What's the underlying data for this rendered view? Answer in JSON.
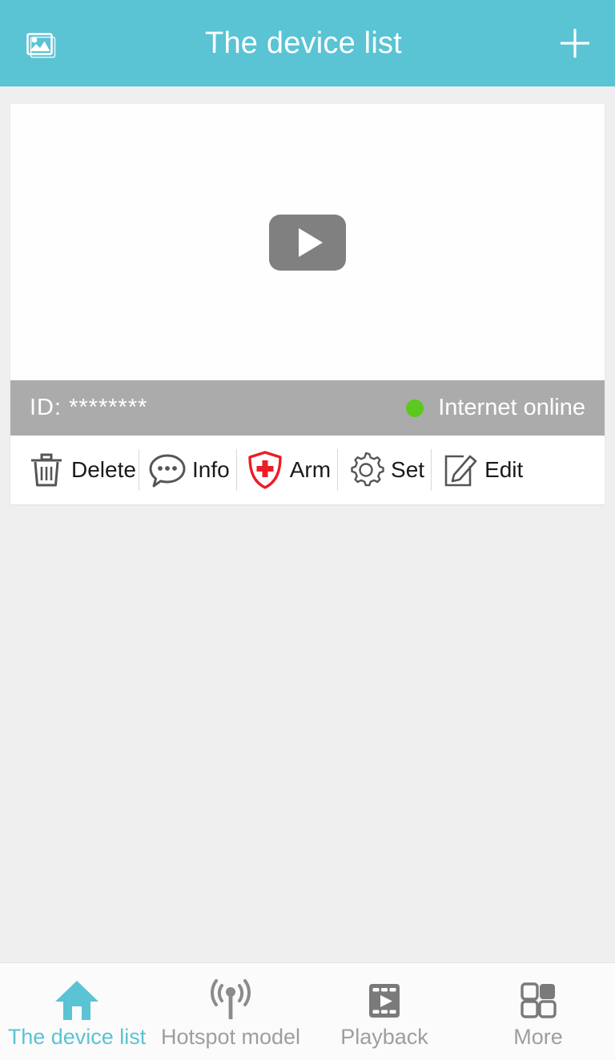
{
  "header": {
    "gallery_icon": "photo-stack-icon",
    "title": "The device list",
    "add_icon": "plus-icon",
    "bg_color": "#5ac3d4"
  },
  "device": {
    "video": {
      "play_icon": "play-icon",
      "bg_color": "#fefefe"
    },
    "status": {
      "id_label": "ID: ********",
      "connection_text": "Internet online",
      "dot_color": "#5cc91e",
      "bar_color": "#ababab"
    },
    "actions": [
      {
        "label": "Delete",
        "icon": "trash-icon",
        "color": "#555555"
      },
      {
        "label": "Info",
        "icon": "speech-bubble-icon",
        "color": "#555555"
      },
      {
        "label": "Arm",
        "icon": "shield-cross-icon",
        "color": "#ed1c24"
      },
      {
        "label": "Set",
        "icon": "gear-icon",
        "color": "#555555"
      },
      {
        "label": "Edit",
        "icon": "pencil-note-icon",
        "color": "#555555"
      }
    ]
  },
  "bottom_nav": {
    "active_color": "#5ac3d4",
    "inactive_color": "#9e9e9e",
    "items": [
      {
        "label": "The device list",
        "icon": "home-icon",
        "active": true
      },
      {
        "label": "Hotspot model",
        "icon": "broadcast-antenna-icon",
        "active": false
      },
      {
        "label": "Playback",
        "icon": "film-play-icon",
        "active": false
      },
      {
        "label": "More",
        "icon": "grid-four-icon",
        "active": false
      }
    ]
  }
}
